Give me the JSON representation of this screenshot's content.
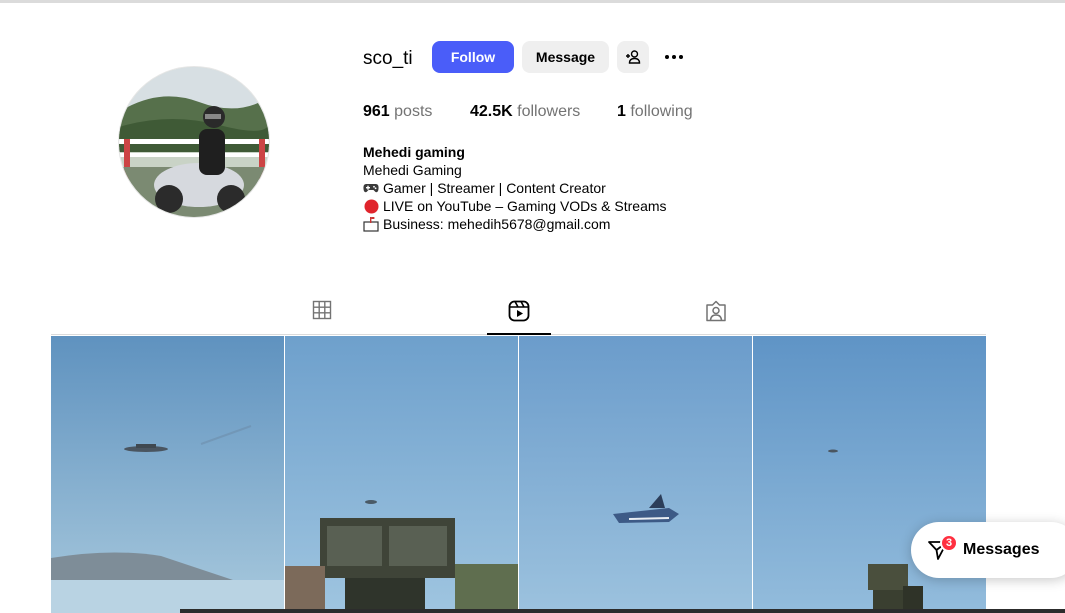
{
  "profile": {
    "username": "sco_ti",
    "follow_label": "Follow",
    "message_label": "Message",
    "stats": {
      "posts_count": "961",
      "posts_label": "posts",
      "followers_count": "42.5K",
      "followers_label": "followers",
      "following_count": "1",
      "following_label": "following"
    },
    "bio": {
      "name": "Mehedi gaming",
      "line1": "Mehedi Gaming",
      "line2": "Gamer | Streamer | Content Creator",
      "line3": "LIVE on YouTube – Gaming VODs & Streams",
      "line4": "Business: mehedih5678@gmail.com"
    }
  },
  "icons": {
    "add_user": "person-plus-icon",
    "more": "more-options-icon",
    "posts_tab": "grid-icon",
    "reels_tab": "reels-icon",
    "tagged_tab": "tagged-icon",
    "messages": "messenger-icon"
  },
  "tabs": {
    "active": "reels"
  },
  "messages": {
    "label": "Messages",
    "badge": "3"
  },
  "colors": {
    "accent": "#4a5df9",
    "badge": "#ff3040"
  }
}
